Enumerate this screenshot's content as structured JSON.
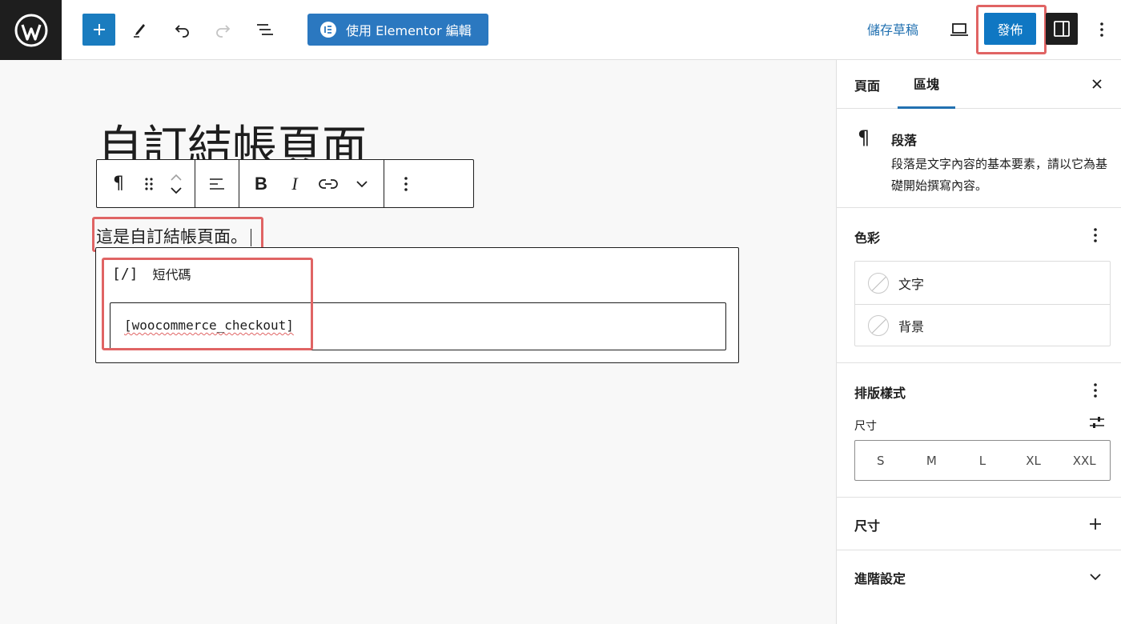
{
  "header": {
    "elementor_button": "使用 Elementor 編輯",
    "save_draft": "儲存草稿",
    "publish": "發佈"
  },
  "editor": {
    "page_title": "自訂結帳頁面",
    "paragraph": "這是自訂結帳頁面。",
    "shortcode_icon": "[/]",
    "shortcode_label": "短代碼",
    "shortcode_value": "[woocommerce_checkout]"
  },
  "sidebar": {
    "tabs": {
      "page": "頁面",
      "block": "區塊"
    },
    "block_card": {
      "title": "段落",
      "description": "段落是文字內容的基本要素，請以它為基礎開始撰寫內容。"
    },
    "color": {
      "title": "色彩",
      "items": [
        "文字",
        "背景"
      ]
    },
    "typography": {
      "title": "排版樣式",
      "size_label": "尺寸",
      "sizes": [
        "S",
        "M",
        "L",
        "XL",
        "XXL"
      ]
    },
    "dimensions": {
      "title": "尺寸"
    },
    "advanced": {
      "title": "進階設定"
    }
  },
  "colors": {
    "accent": "#2271b1",
    "publish": "#0f77c3",
    "highlight": "#e06464"
  },
  "icons": [
    "wordpress-logo-icon",
    "plus-icon",
    "pen-icon",
    "undo-icon",
    "redo-icon",
    "list-view-icon",
    "elementor-icon",
    "desktop-preview-icon",
    "sidebar-toggle-icon",
    "more-vertical-icon",
    "pilcrow-icon",
    "drag-handle-icon",
    "move-up-icon",
    "move-down-icon",
    "align-left-icon",
    "bold-icon",
    "italic-icon",
    "link-icon",
    "chevron-down-icon",
    "close-icon",
    "plus-icon",
    "sliders-icon"
  ]
}
